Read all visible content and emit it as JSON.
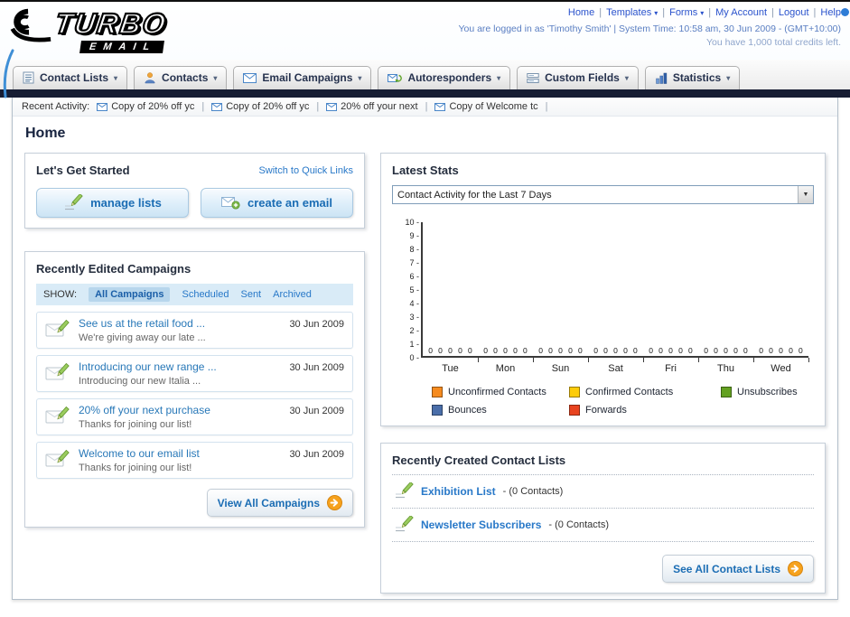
{
  "header": {
    "logo": {
      "line1": "TURBO",
      "line2": "EMAIL"
    },
    "nav": {
      "separator": "|",
      "links": [
        {
          "label": "Home",
          "dropdown": false
        },
        {
          "label": "Templates",
          "dropdown": true
        },
        {
          "label": "Forms",
          "dropdown": true
        },
        {
          "label": "My Account",
          "dropdown": false
        },
        {
          "label": "Logout",
          "dropdown": false
        },
        {
          "label": "Help",
          "dropdown": false
        }
      ]
    },
    "session_line": "You are logged in as 'Timothy Smith' | System Time: 10:58 am, 30 Jun 2009 - (GMT+10:00)",
    "credits_line": "You have 1,000 total credits left."
  },
  "tabs": [
    {
      "label": "Contact Lists",
      "icon": "contact-lists-icon"
    },
    {
      "label": "Contacts",
      "icon": "contacts-icon"
    },
    {
      "label": "Email Campaigns",
      "icon": "email-campaigns-icon"
    },
    {
      "label": "Autoresponders",
      "icon": "autoresponders-icon"
    },
    {
      "label": "Custom Fields",
      "icon": "custom-fields-icon"
    },
    {
      "label": "Statistics",
      "icon": "statistics-icon"
    }
  ],
  "recent_activity": {
    "label": "Recent Activity:",
    "separator": "|",
    "items": [
      "Copy of 20% off yc",
      "Copy of 20% off yc",
      "20% off your next",
      "Copy of Welcome tc"
    ]
  },
  "page": {
    "title": "Home"
  },
  "get_started": {
    "title": "Let's Get Started",
    "switch_link": "Switch to Quick Links",
    "manage_lists_label": "manage lists",
    "create_email_label": "create an email"
  },
  "campaigns": {
    "title": "Recently Edited Campaigns",
    "show_label": "SHOW:",
    "filters": [
      "All Campaigns",
      "Scheduled",
      "Sent",
      "Archived"
    ],
    "active_filter": "All Campaigns",
    "items": [
      {
        "title": "See us at the retail food ...",
        "subtitle": "We're giving away our late ...",
        "date": "30 Jun 2009"
      },
      {
        "title": "Introducing our new range ...",
        "subtitle": "Introducing our new Italia ...",
        "date": "30 Jun 2009"
      },
      {
        "title": "20% off your next purchase",
        "subtitle": "Thanks for joining our list!",
        "date": "30 Jun 2009"
      },
      {
        "title": "Welcome to our email list",
        "subtitle": "Thanks for joining our list!",
        "date": "30 Jun 2009"
      }
    ],
    "view_all_label": "View All Campaigns"
  },
  "stats": {
    "title": "Latest Stats",
    "selected_option": "Contact Activity for the Last 7 Days"
  },
  "chart_data": {
    "type": "bar",
    "title": "Contact Activity for the Last 7 Days",
    "categories": [
      "Tue",
      "Mon",
      "Sun",
      "Sat",
      "Fri",
      "Thu",
      "Wed"
    ],
    "series": [
      {
        "name": "Unconfirmed Contacts",
        "color": "#f68b1f",
        "values": [
          0,
          0,
          0,
          0,
          0,
          0,
          0
        ]
      },
      {
        "name": "Confirmed Contacts",
        "color": "#fdcc09",
        "values": [
          0,
          0,
          0,
          0,
          0,
          0,
          0
        ]
      },
      {
        "name": "Unsubscribes",
        "color": "#63a121",
        "values": [
          0,
          0,
          0,
          0,
          0,
          0,
          0
        ]
      },
      {
        "name": "Bounces",
        "color": "#4a6ea9",
        "values": [
          0,
          0,
          0,
          0,
          0,
          0,
          0
        ]
      },
      {
        "name": "Forwards",
        "color": "#e8431f",
        "values": [
          0,
          0,
          0,
          0,
          0,
          0,
          0
        ]
      }
    ],
    "ylim": [
      0,
      10
    ],
    "yticks": [
      0,
      1,
      2,
      3,
      4,
      5,
      6,
      7,
      8,
      9,
      10
    ],
    "grid": false,
    "legend_position": "bottom",
    "xlabel": "",
    "ylabel": ""
  },
  "contact_lists": {
    "title": "Recently Created Contact Lists",
    "items": [
      {
        "name": "Exhibition List",
        "suffix": "- (0 Contacts)"
      },
      {
        "name": "Newsletter Subscribers",
        "suffix": "- (0 Contacts)"
      }
    ],
    "see_all_label": "See All Contact Lists"
  }
}
